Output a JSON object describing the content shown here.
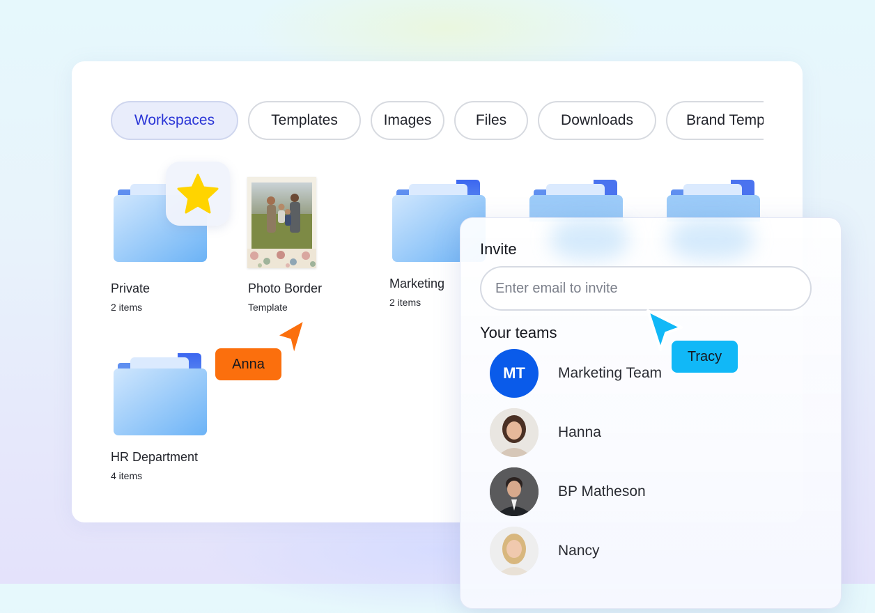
{
  "tabs": [
    {
      "label": "Workspaces",
      "active": true
    },
    {
      "label": "Templates",
      "active": false
    },
    {
      "label": "Images",
      "active": false
    },
    {
      "label": "Files",
      "active": false
    },
    {
      "label": "Downloads",
      "active": false
    },
    {
      "label": "Brand Templates",
      "active": false
    }
  ],
  "folders": [
    {
      "name": "Private",
      "sub": "2 items",
      "icon": "folder-icon",
      "favorite": true
    },
    {
      "name": "Photo Border",
      "sub": "Template",
      "icon": "photo-template-thumbnail"
    },
    {
      "name": "Marketing",
      "sub": "2 items",
      "icon": "folder-icon"
    },
    {
      "name": "HR Department",
      "sub": "4 items",
      "icon": "folder-icon"
    }
  ],
  "cursors": [
    {
      "name": "Anna",
      "color": "#fb6f0d"
    },
    {
      "name": "Tracy",
      "color": "#11b8f7"
    }
  ],
  "invite": {
    "title": "Invite",
    "placeholder": "Enter email to invite",
    "teams_title": "Your teams",
    "members": [
      {
        "initials": "MT",
        "name": "Marketing Team",
        "avatar": "initials",
        "color": "#0a5bea"
      },
      {
        "name": "Hanna",
        "avatar": "photo-avatar"
      },
      {
        "name": "BP Matheson",
        "avatar": "photo-avatar"
      },
      {
        "name": "Nancy",
        "avatar": "photo-avatar"
      }
    ]
  },
  "colors": {
    "active_tab_text": "#2a35d6",
    "active_tab_bg": "#e9edfb",
    "folder_blue": "#5fa8f2",
    "star": "#ffd400"
  }
}
